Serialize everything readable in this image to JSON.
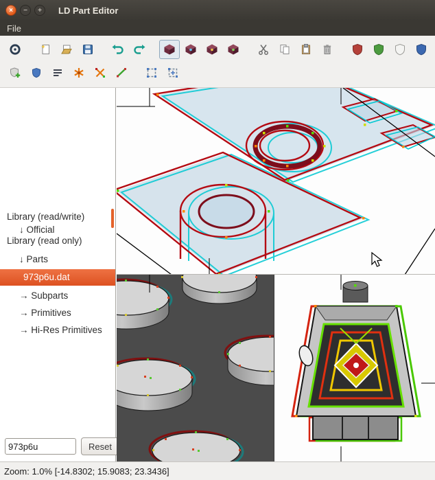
{
  "window": {
    "title": "LD Part Editor",
    "buttons": {
      "close": "×",
      "minimize": "−",
      "maximize": "+"
    }
  },
  "menubar": {
    "items": [
      {
        "label": "File"
      }
    ]
  },
  "toolbar": {
    "row1_icons": [
      "sync-icon",
      "new-file-icon",
      "open-file-icon",
      "save-icon",
      "undo-icon",
      "redo-icon",
      "render-mode-1-icon",
      "render-mode-2-icon",
      "render-mode-3-icon",
      "render-mode-4-icon",
      "cut-icon",
      "copy-icon",
      "paste-icon",
      "delete-icon",
      "shield-red-icon",
      "shield-green-icon",
      "shield-white-icon",
      "shield-blue-icon"
    ],
    "row2_icons": [
      "shield-plus-icon",
      "shield-small-blue-icon",
      "text-lines-icon",
      "star-orange-icon",
      "cross-orange-icon",
      "line-green-icon",
      "selection-box-icon",
      "selection-grid-icon"
    ]
  },
  "sidebar": {
    "items": [
      {
        "label": "Library (read/write)"
      },
      {
        "label": "↓ Official"
      },
      {
        "label": "Library (read only)"
      },
      {
        "label": "↓ Parts"
      },
      {
        "label": "973p6u.dat",
        "selected": true
      },
      {
        "label": "→ Subparts"
      },
      {
        "label": "→ Primitives"
      },
      {
        "label": "→ Hi-Res Primitives"
      }
    ],
    "filter_value": "973p6u",
    "reset_label": "Reset"
  },
  "statusbar": {
    "text": "Zoom: 1.0% [-14.8302; 15.9083; 23.3436]"
  },
  "colors": {
    "selection": "#E4622A",
    "titlebar": "#3A3833",
    "toolbar_bg": "#F1F0EE",
    "viewport_dark_bg": "#4B4B4B",
    "anaglyph_red": "#B40A12",
    "anaglyph_cyan": "#00C8D2"
  }
}
